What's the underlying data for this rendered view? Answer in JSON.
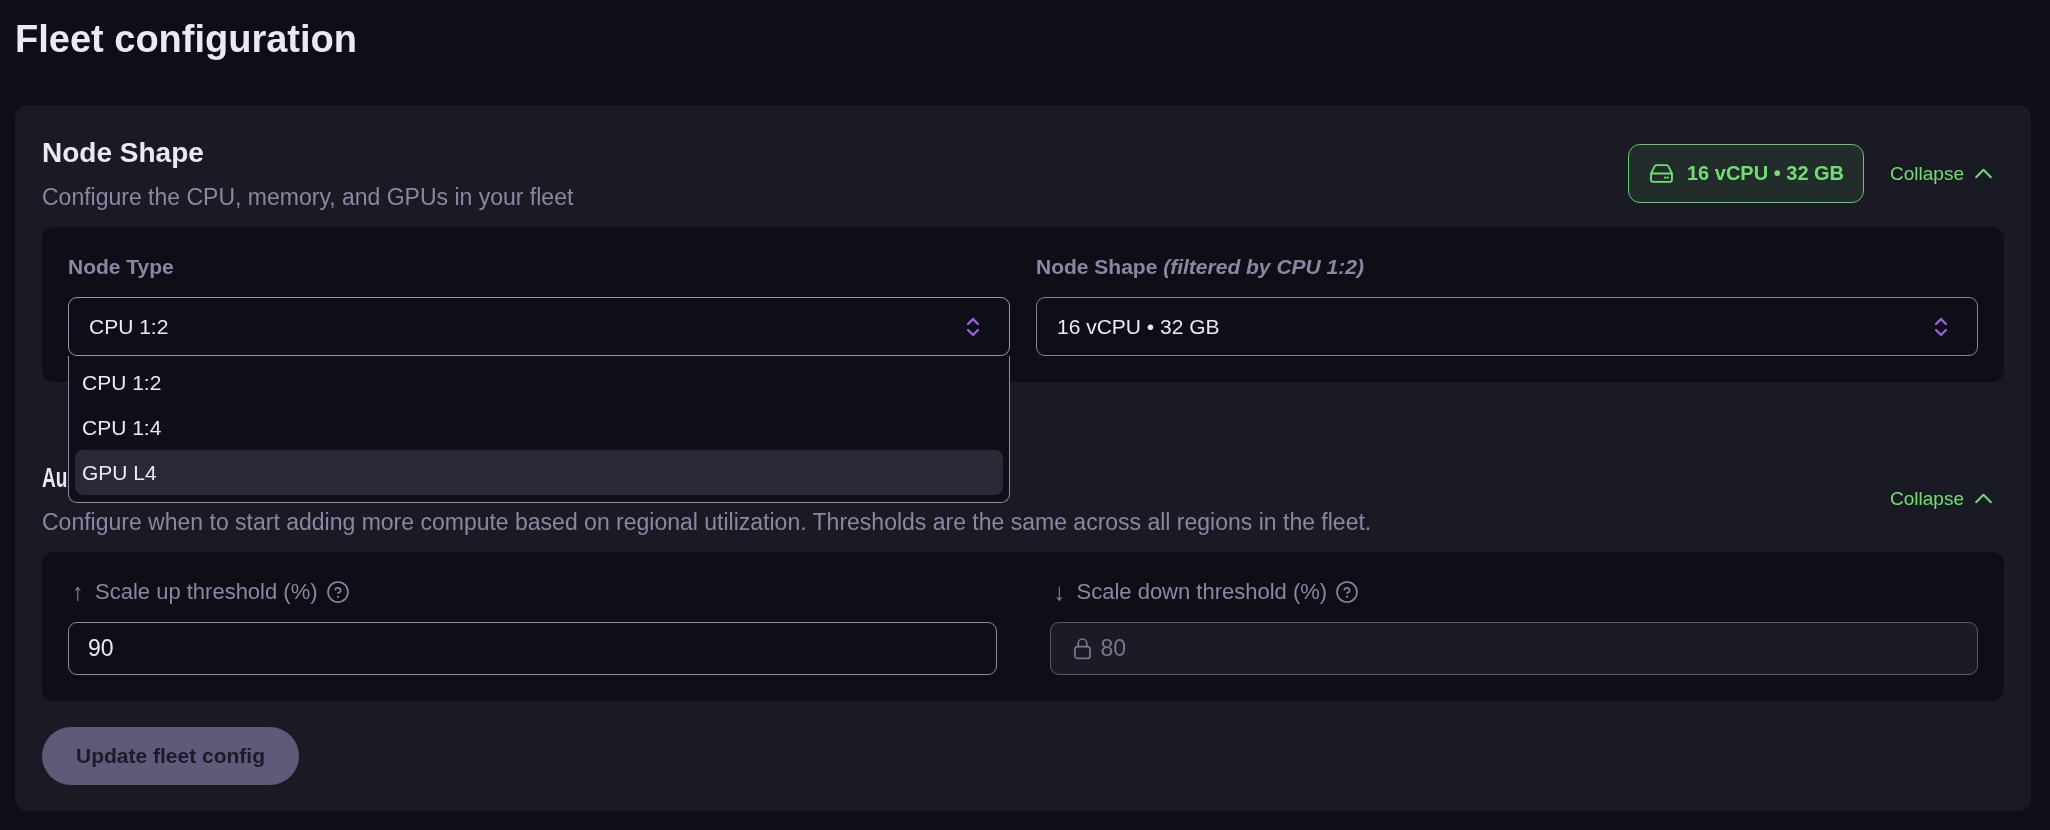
{
  "title": "Fleet configuration",
  "sections": [
    {
      "heading": "Node Shape",
      "description": "Configure the CPU, memory, and GPUs in your fleet",
      "badge": "16 vCPU • 32 GB",
      "toggle": "Collapse",
      "expanded": true,
      "fields": [
        {
          "kind": "select",
          "label": "Node Type",
          "value": "CPU 1:2",
          "open": true,
          "options": [
            {
              "label": "CPU 1:2",
              "highlighted": false
            },
            {
              "label": "CPU 1:4",
              "highlighted": false
            },
            {
              "label": "GPU L4",
              "highlighted": true
            }
          ]
        },
        {
          "kind": "select",
          "label": "Node Shape *(filtered by CPU 1:2)*",
          "value": "16 vCPU • 32 GB",
          "open": false
        }
      ]
    },
    {
      "heading": "Au",
      "description": "Configure when to start adding more compute based on regional utilization. Thresholds are the same across all regions in the fleet.",
      "toggle": "Collapse",
      "expanded": true,
      "fields": [
        {
          "kind": "number",
          "arrow": "↑",
          "label": "Scale up threshold (%)",
          "value": "90",
          "disabled": false
        },
        {
          "kind": "number",
          "arrow": "↓",
          "label": "Scale down threshold (%)",
          "value": "80",
          "disabled": true
        }
      ]
    }
  ],
  "submit": {
    "label": "Update fleet config",
    "disabled": true
  }
}
